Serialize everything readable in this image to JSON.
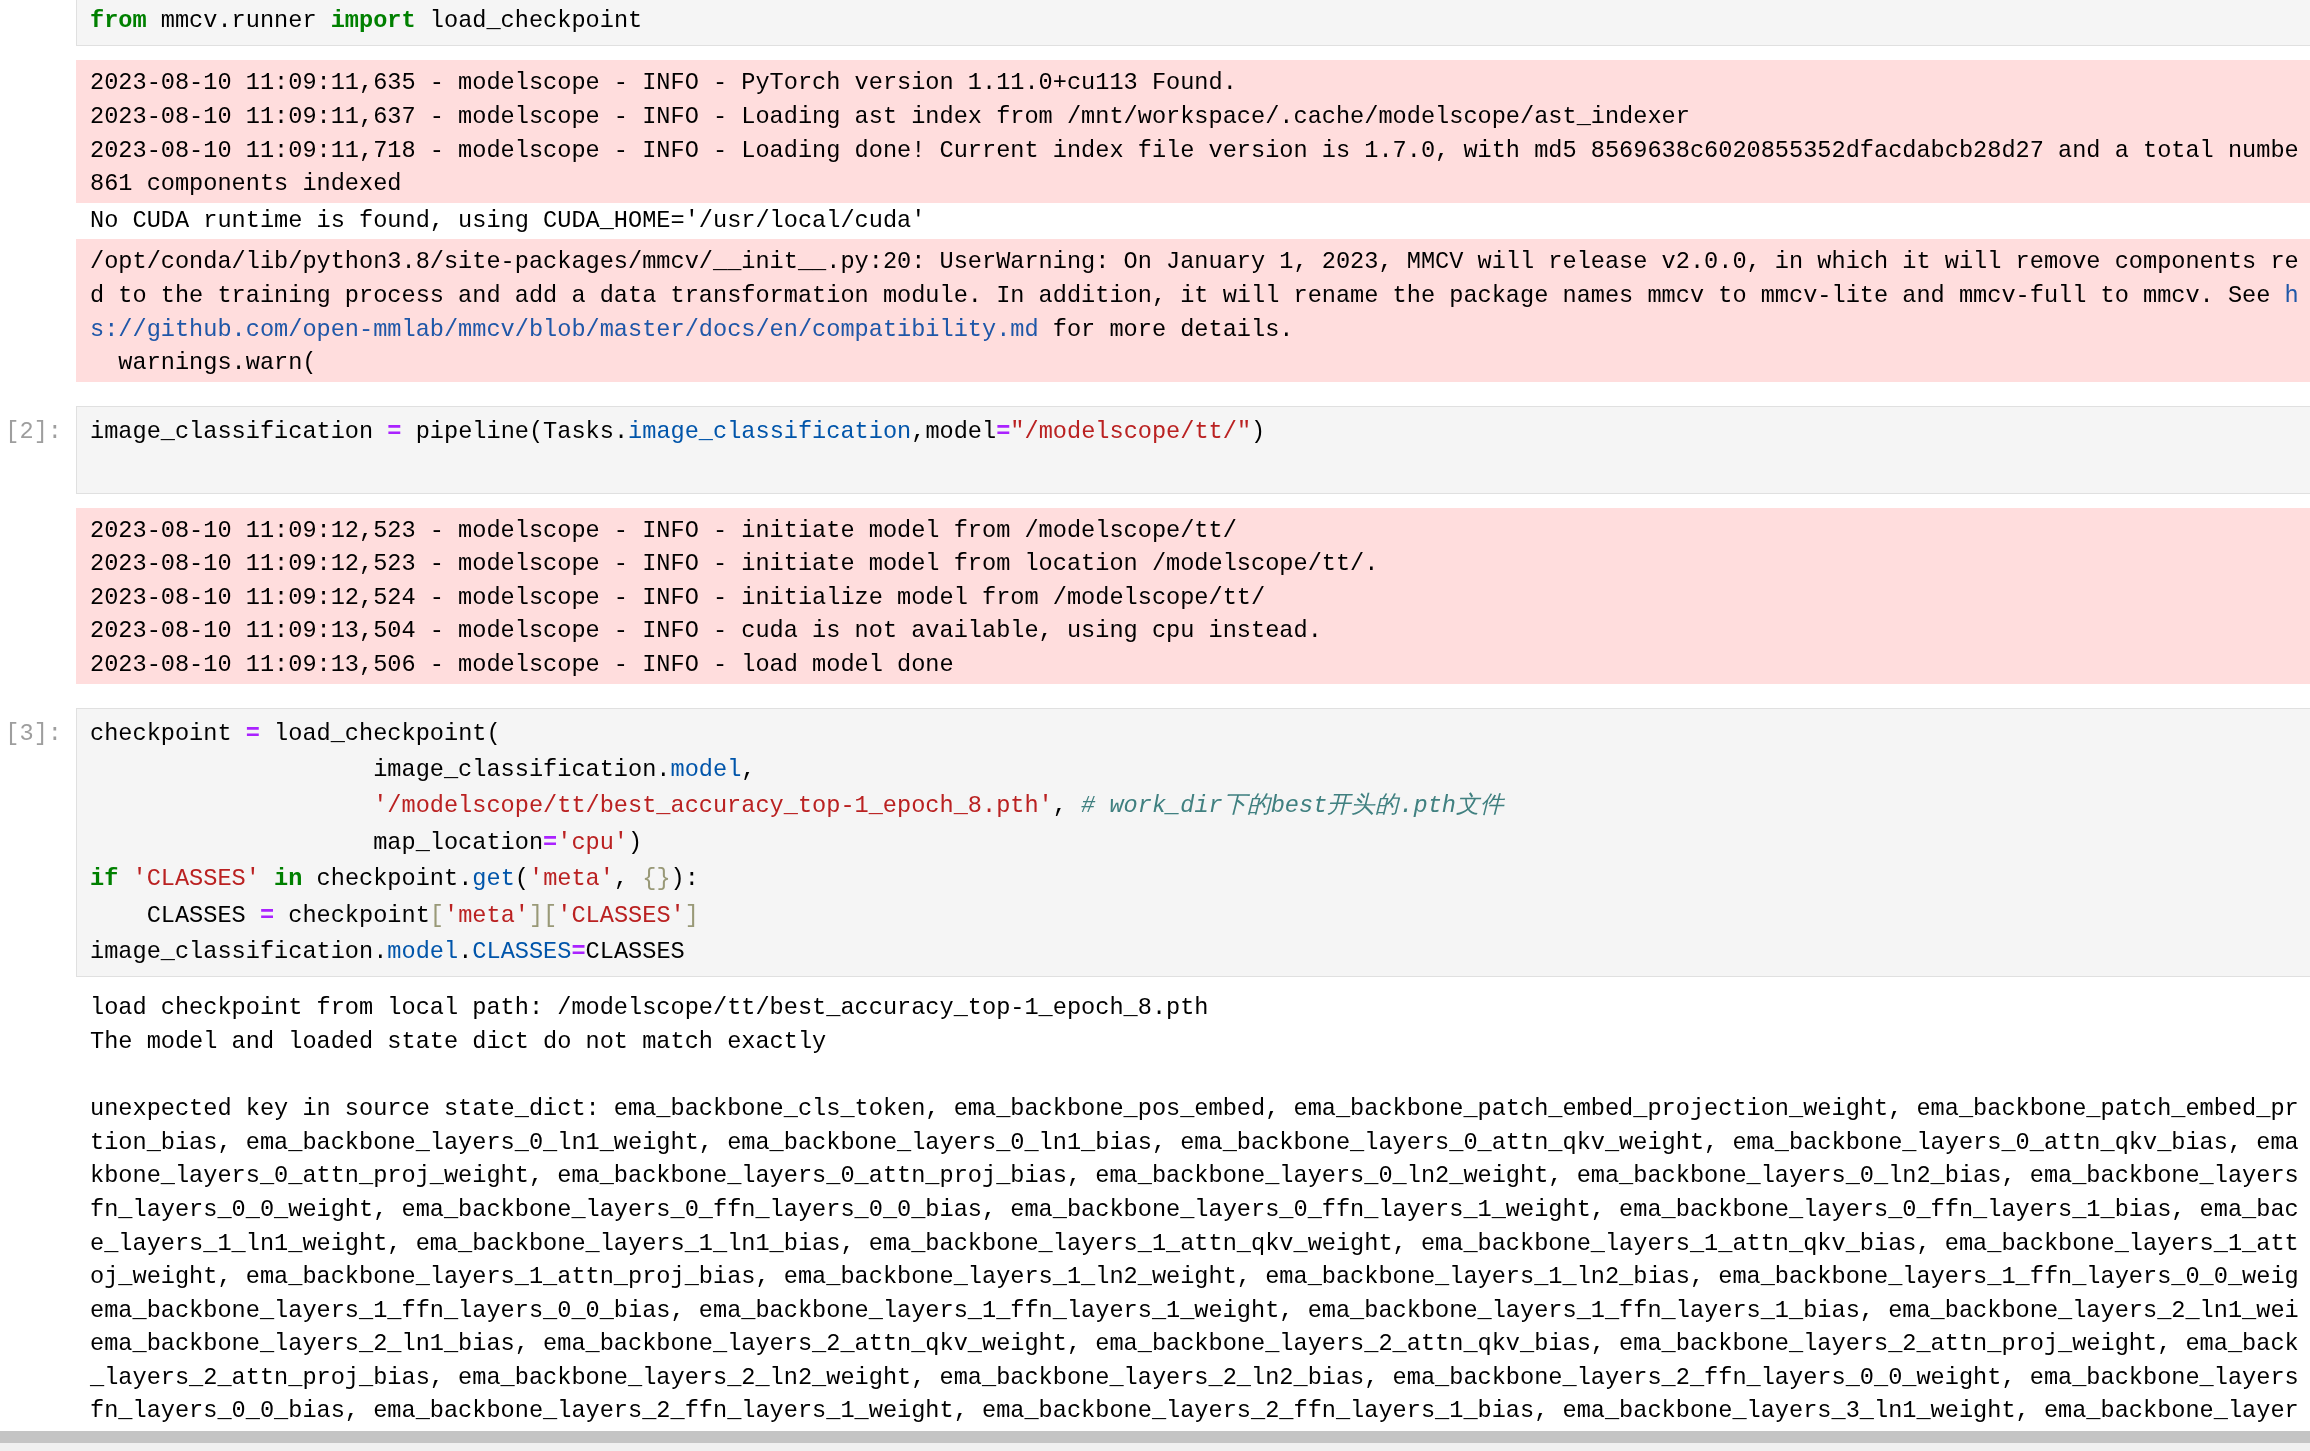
{
  "cells": [
    {
      "source": [
        [
          {
            "kind": "keyword",
            "text": "from"
          },
          {
            "kind": "plain",
            "text": " mmcv.runner "
          },
          {
            "kind": "keyword",
            "text": "import"
          },
          {
            "kind": "plain",
            "text": " load_checkpoint"
          }
        ]
      ],
      "outputs": [
        {
          "kind": "stderr",
          "paragraphs": [
            [
              "2023-08-10 11:09:11,635 - modelscope - INFO - PyTorch version 1.11.0+cu113 Found.",
              "2023-08-10 11:09:11,637 - modelscope - INFO - Loading ast index from /mnt/workspace/.cache/modelscope/ast_indexer",
              "2023-08-10 11:09:11,718 - modelscope - INFO - Loading done! Current index file version is 1.7.0, with md5 8569638c6020855352dfacdabcb28d27 and a total numbe",
              "861 components indexed"
            ]
          ]
        },
        {
          "kind": "stdout",
          "paragraphs": [
            [
              "No CUDA runtime is found, using CUDA_HOME='/usr/local/cuda'"
            ]
          ]
        },
        {
          "kind": "stderr",
          "paragraphs": [
            [
              "/opt/conda/lib/python3.8/site-packages/mmcv/__init__.py:20: UserWarning: On January 1, 2023, MMCV will release v2.0.0, in which it will remove components re",
              [
                {
                  "kind": "plain",
                  "text": "d to the training process and add a data transformation module. In addition, it will rename the package names mmcv to mmcv-lite and mmcv-full to mmcv. See "
                },
                {
                  "kind": "link",
                  "text": "h"
                }
              ],
              [
                {
                  "kind": "link",
                  "text": "s://github.com/open-mmlab/mmcv/blob/master/docs/en/compatibility.md"
                },
                {
                  "kind": "plain",
                  "text": " for more details."
                }
              ],
              "  warnings.warn("
            ]
          ]
        }
      ]
    },
    {
      "prompt": "[2]:",
      "source": [
        [
          {
            "kind": "plain",
            "text": "image_classification "
          },
          {
            "kind": "operator",
            "text": "="
          },
          {
            "kind": "plain",
            "text": " pipeline(Tasks."
          },
          {
            "kind": "property",
            "text": "image_classification"
          },
          {
            "kind": "plain",
            "text": ",model"
          },
          {
            "kind": "operator",
            "text": "="
          },
          {
            "kind": "string",
            "text": "\"/modelscope/tt/\""
          },
          {
            "kind": "plain",
            "text": ")"
          }
        ]
      ],
      "outputs": [
        {
          "kind": "stderr",
          "paragraphs": [
            [
              "2023-08-10 11:09:12,523 - modelscope - INFO - initiate model from /modelscope/tt/",
              "2023-08-10 11:09:12,523 - modelscope - INFO - initiate model from location /modelscope/tt/.",
              "2023-08-10 11:09:12,524 - modelscope - INFO - initialize model from /modelscope/tt/",
              "2023-08-10 11:09:13,504 - modelscope - INFO - cuda is not available, using cpu instead.",
              "2023-08-10 11:09:13,506 - modelscope - INFO - load model done"
            ]
          ]
        }
      ]
    },
    {
      "prompt": "[3]:",
      "source": [
        [
          {
            "kind": "plain",
            "text": "checkpoint "
          },
          {
            "kind": "operator",
            "text": "="
          },
          {
            "kind": "plain",
            "text": " load_checkpoint("
          }
        ],
        [
          {
            "kind": "plain",
            "text": "                    image_classification."
          },
          {
            "kind": "property",
            "text": "model"
          },
          {
            "kind": "plain",
            "text": ","
          }
        ],
        [
          {
            "kind": "string",
            "text": "                    '/modelscope/tt/best_accuracy_top-1_epoch_8.pth'"
          },
          {
            "kind": "plain",
            "text": ", "
          },
          {
            "kind": "comment",
            "text": "# work_dir下的best开头的.pth文件"
          }
        ],
        [
          {
            "kind": "plain",
            "text": "                    map_location"
          },
          {
            "kind": "operator",
            "text": "="
          },
          {
            "kind": "string",
            "text": "'cpu'"
          },
          {
            "kind": "plain",
            "text": ")"
          }
        ],
        [
          {
            "kind": "keyword",
            "text": "if "
          },
          {
            "kind": "string",
            "text": "'CLASSES' "
          },
          {
            "kind": "keyword",
            "text": "in"
          },
          {
            "kind": "plain",
            "text": " checkpoint."
          },
          {
            "kind": "property",
            "text": "get"
          },
          {
            "kind": "plain",
            "text": "("
          },
          {
            "kind": "string",
            "text": "'meta'"
          },
          {
            "kind": "plain",
            "text": ", "
          },
          {
            "kind": "bracket",
            "text": "{}"
          },
          {
            "kind": "plain",
            "text": "):"
          }
        ],
        [
          {
            "kind": "plain",
            "text": "    CLASSES "
          },
          {
            "kind": "operator",
            "text": "="
          },
          {
            "kind": "plain",
            "text": " checkpoint"
          },
          {
            "kind": "bracket",
            "text": "["
          },
          {
            "kind": "string",
            "text": "'meta'"
          },
          {
            "kind": "bracket",
            "text": "]["
          },
          {
            "kind": "string",
            "text": "'CLASSES'"
          },
          {
            "kind": "bracket",
            "text": "]"
          }
        ],
        [
          {
            "kind": "plain",
            "text": "image_classification."
          },
          {
            "kind": "property",
            "text": "model"
          },
          {
            "kind": "plain",
            "text": "."
          },
          {
            "kind": "property",
            "text": "CLASSES"
          },
          {
            "kind": "operator",
            "text": "="
          },
          {
            "kind": "plain",
            "text": "CLASSES"
          }
        ]
      ],
      "outputs": [
        {
          "kind": "stdout",
          "paragraphs": [
            [
              "load checkpoint from local path: /modelscope/tt/best_accuracy_top-1_epoch_8.pth",
              "The model and loaded state dict do not match exactly"
            ],
            [
              "unexpected key in source state_dict: ema_backbone_cls_token, ema_backbone_pos_embed, ema_backbone_patch_embed_projection_weight, ema_backbone_patch_embed_pr",
              "tion_bias, ema_backbone_layers_0_ln1_weight, ema_backbone_layers_0_ln1_bias, ema_backbone_layers_0_attn_qkv_weight, ema_backbone_layers_0_attn_qkv_bias, ema",
              "kbone_layers_0_attn_proj_weight, ema_backbone_layers_0_attn_proj_bias, ema_backbone_layers_0_ln2_weight, ema_backbone_layers_0_ln2_bias, ema_backbone_layers",
              "fn_layers_0_0_weight, ema_backbone_layers_0_ffn_layers_0_0_bias, ema_backbone_layers_0_ffn_layers_1_weight, ema_backbone_layers_0_ffn_layers_1_bias, ema_bac",
              "e_layers_1_ln1_weight, ema_backbone_layers_1_ln1_bias, ema_backbone_layers_1_attn_qkv_weight, ema_backbone_layers_1_attn_qkv_bias, ema_backbone_layers_1_att",
              "oj_weight, ema_backbone_layers_1_attn_proj_bias, ema_backbone_layers_1_ln2_weight, ema_backbone_layers_1_ln2_bias, ema_backbone_layers_1_ffn_layers_0_0_weig",
              "ema_backbone_layers_1_ffn_layers_0_0_bias, ema_backbone_layers_1_ffn_layers_1_weight, ema_backbone_layers_1_ffn_layers_1_bias, ema_backbone_layers_2_ln1_wei",
              "ema_backbone_layers_2_ln1_bias, ema_backbone_layers_2_attn_qkv_weight, ema_backbone_layers_2_attn_qkv_bias, ema_backbone_layers_2_attn_proj_weight, ema_back",
              "_layers_2_attn_proj_bias, ema_backbone_layers_2_ln2_weight, ema_backbone_layers_2_ln2_bias, ema_backbone_layers_2_ffn_layers_0_0_weight, ema_backbone_layers",
              "fn_layers_0_0_bias, ema_backbone_layers_2_ffn_layers_1_weight, ema_backbone_layers_2_ffn_layers_1_bias, ema_backbone_layers_3_ln1_weight, ema_backbone_layer"
            ]
          ]
        }
      ]
    }
  ]
}
